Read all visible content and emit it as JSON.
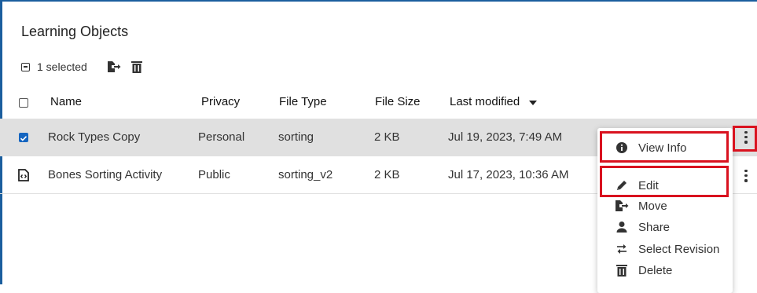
{
  "page": {
    "title": "Learning Objects",
    "selection_text": "1 selected",
    "accent_color": "#1565c0",
    "highlight_color": "#d9121f"
  },
  "table": {
    "columns": [
      "Name",
      "Privacy",
      "File Type",
      "File Size",
      "Last modified"
    ],
    "sort_column": "Last modified",
    "sort_direction": "descending",
    "rows": [
      {
        "name": "Rock Types Copy",
        "privacy": "Personal",
        "file_type": "sorting",
        "file_size": "2 KB",
        "last_modified": "Jul 19, 2023, 7:49 AM",
        "selected": true
      },
      {
        "name": "Bones Sorting Activity",
        "privacy": "Public",
        "file_type": "sorting_v2",
        "file_size": "2 KB",
        "last_modified": "Jul 17, 2023, 10:36 AM",
        "selected": false
      }
    ]
  },
  "context_menu": {
    "items": [
      {
        "label": "View Info",
        "icon": "info-icon"
      },
      {
        "label": "Edit",
        "icon": "pencil-icon"
      },
      {
        "label": "Move",
        "icon": "move-icon"
      },
      {
        "label": "Share",
        "icon": "person-icon"
      },
      {
        "label": "Select Revision",
        "icon": "swap-arrows-icon"
      },
      {
        "label": "Delete",
        "icon": "trash-icon"
      }
    ]
  }
}
